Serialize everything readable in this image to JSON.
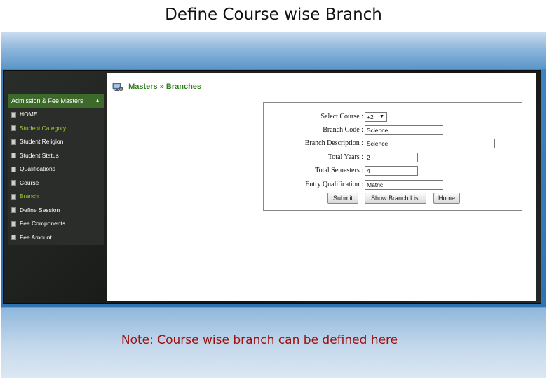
{
  "slide": {
    "title": "Define Course wise Branch",
    "note": "Note: Course wise branch can be defined here"
  },
  "sidebar": {
    "header": "Admission & Fee Masters",
    "caret": "▲",
    "items": [
      {
        "label": "HOME",
        "active": false
      },
      {
        "label": "Student Category",
        "active": true
      },
      {
        "label": "Student Religion",
        "active": false
      },
      {
        "label": "Student Status",
        "active": false
      },
      {
        "label": "Qualifications",
        "active": false
      },
      {
        "label": "Course",
        "active": false
      },
      {
        "label": "Branch",
        "active": true
      },
      {
        "label": "Define Session",
        "active": false
      },
      {
        "label": "Fee Components",
        "active": false
      },
      {
        "label": "Fee Amount",
        "active": false
      }
    ]
  },
  "breadcrumb": {
    "masters": "Masters",
    "separator": "»",
    "branches": "Branches",
    "icon": "monitor-gear-icon"
  },
  "form": {
    "select_course": {
      "label": "Select Course :",
      "value": "+2"
    },
    "branch_code": {
      "label": "Branch Code :",
      "value": "Science"
    },
    "branch_description": {
      "label": "Branch Description :",
      "value": "Science"
    },
    "total_years": {
      "label": "Total Years :",
      "value": "2"
    },
    "total_semesters": {
      "label": "Total Semesters :",
      "value": "4"
    },
    "entry_qualification": {
      "label": "Entry Qualification :",
      "value": "Matric"
    }
  },
  "buttons": {
    "submit": "Submit",
    "show_branch_list": "Show Branch List",
    "home": "Home"
  },
  "colors": {
    "accent_green": "#2f7d1f",
    "sidebar_active": "#9acd32",
    "note_red": "#a01010",
    "slide_blue": "#2f73b3"
  }
}
